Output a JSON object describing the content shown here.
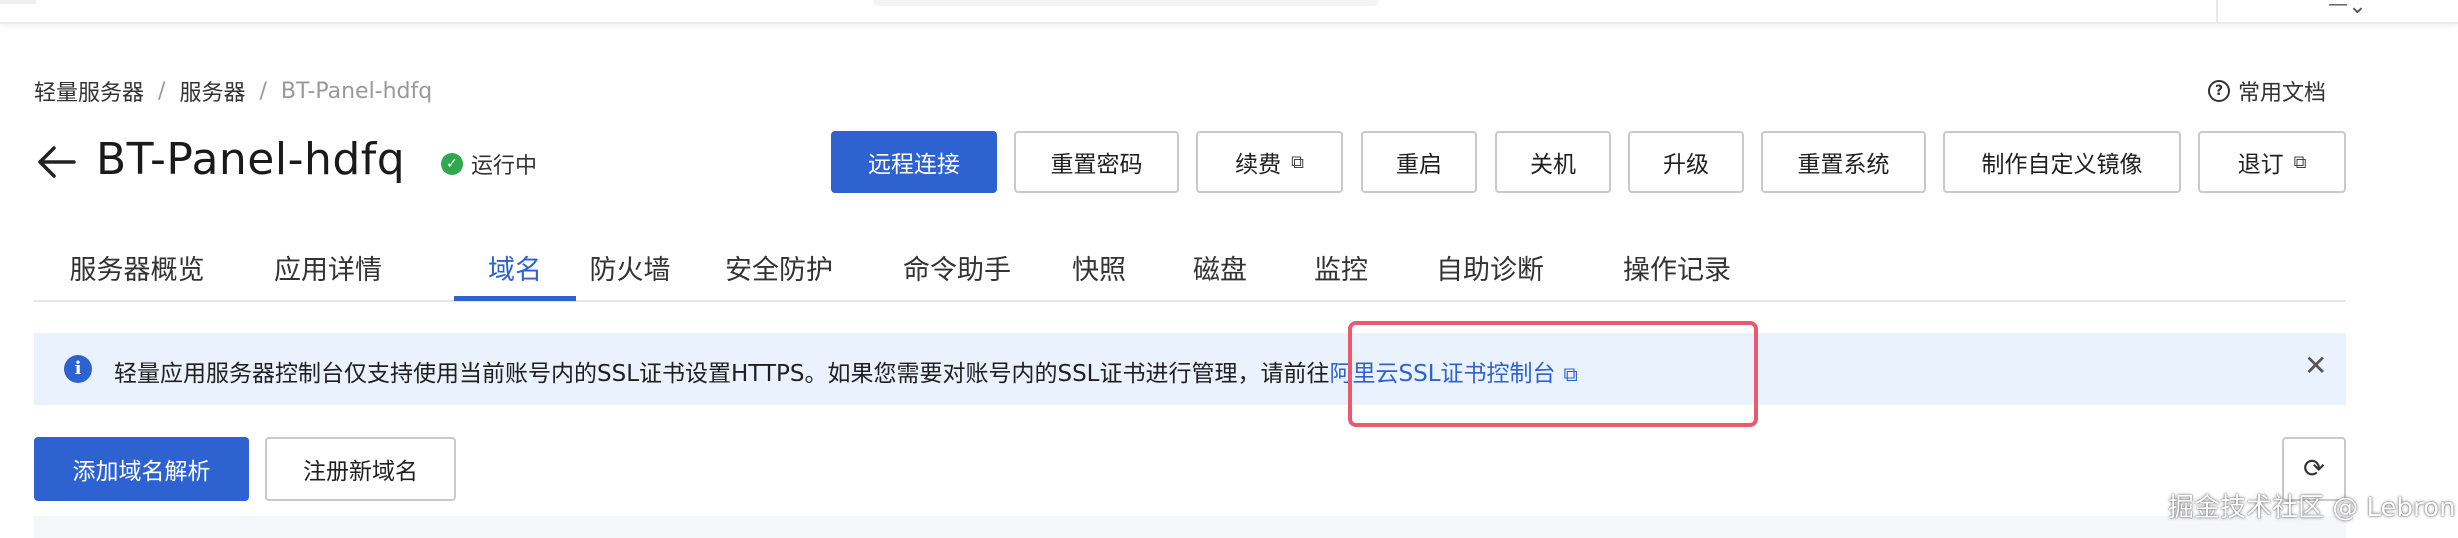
{
  "topbar": {
    "right_text": "ᅳ⌄"
  },
  "breadcrumb": {
    "items": [
      "轻量服务器",
      "服务器",
      "BT-Panel-hdfq"
    ],
    "separator": "/"
  },
  "docs": {
    "icon": "question-circle-icon",
    "label": "常用文档"
  },
  "header": {
    "title": "BT-Panel-hdfq",
    "status": "运行中",
    "status_color": "#2fa84f",
    "buttons": [
      "远程连接",
      "重置密码",
      "续费",
      "重启",
      "关机",
      "升级",
      "重置系统",
      "制作自定义镜像",
      "退订"
    ]
  },
  "tabs": [
    "服务器概览",
    "应用详情",
    "域名",
    "防火墙",
    "安全防护",
    "命令助手",
    "快照",
    "磁盘",
    "监控",
    "自助诊断",
    "操作记录"
  ],
  "active_tab": "域名",
  "notice": {
    "text": "轻量应用服务器控制台仅支持使用当前账号内的SSL证书设置HTTPS。如果您需要对账号内的SSL证书进行管理，请前往",
    "link": "阿里云SSL证书控制台",
    "highlight_color": "#ea5a6c"
  },
  "actions": {
    "add": "添加域名解析",
    "register": "注册新域名"
  },
  "watermark": "掘金技术社区 @ Lebron",
  "colors": {
    "accent": "#2d62d0",
    "notice_bg": "#e9f2fd"
  }
}
